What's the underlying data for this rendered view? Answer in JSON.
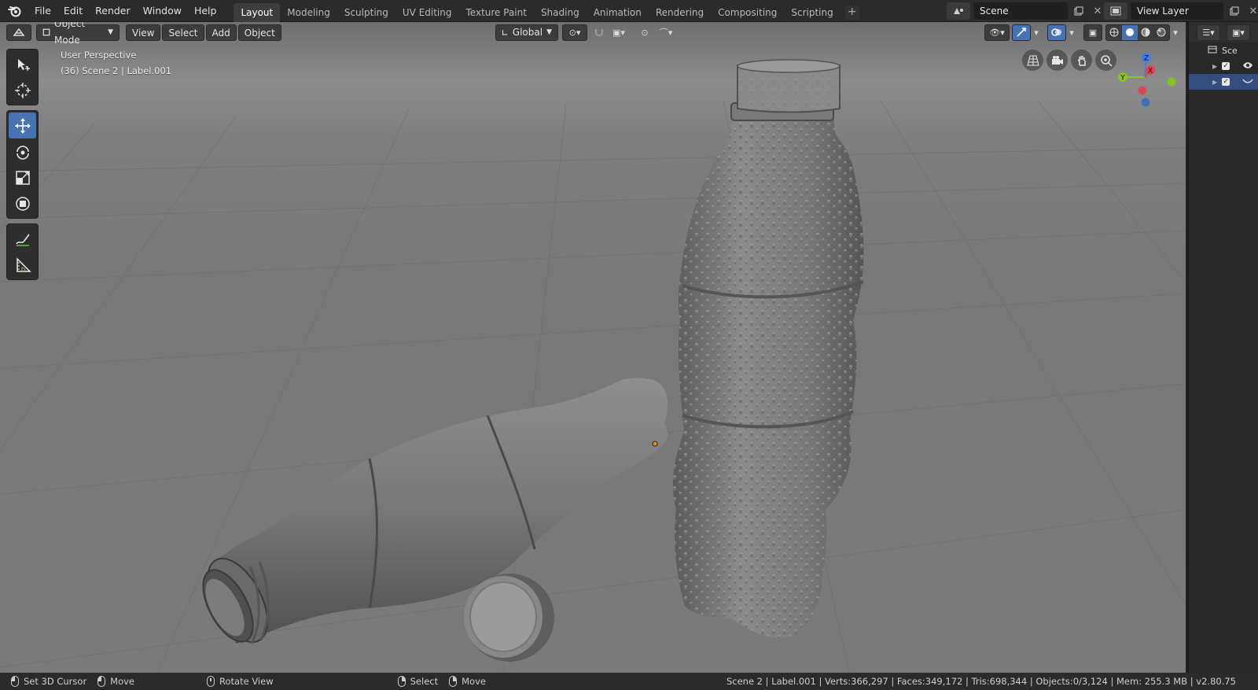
{
  "menu": [
    "File",
    "Edit",
    "Render",
    "Window",
    "Help"
  ],
  "workspaces": [
    "Layout",
    "Modeling",
    "Sculpting",
    "UV Editing",
    "Texture Paint",
    "Shading",
    "Animation",
    "Rendering",
    "Compositing",
    "Scripting"
  ],
  "active_workspace": "Layout",
  "scene_name": "Scene",
  "view_layer_name": "View Layer",
  "viewport_header": {
    "mode": "Object Mode",
    "view": "View",
    "select": "Select",
    "add": "Add",
    "object": "Object",
    "orientation": "Global"
  },
  "overlay": {
    "perspective": "User Perspective",
    "context": "(36) Scene 2 | Label.001"
  },
  "outliner": {
    "header_label": "Sce"
  },
  "statusbar": {
    "left_click": "Set 3D Cursor",
    "left_drag": "Move",
    "middle": "Rotate View",
    "right_click": "Select",
    "right_drag": "Move",
    "stats": "Scene 2 | Label.001 | Verts:366,297 | Faces:349,172 | Tris:698,344 | Objects:0/3,124 | Mem: 255.3 MB | v2.80.75"
  },
  "axis_labels": {
    "x": "X",
    "y": "Y",
    "z": "Z"
  },
  "colors": {
    "accent": "#4772b3",
    "x_axis": "#e5414c",
    "y_axis": "#8bc21e",
    "z_axis": "#3d7fe6"
  }
}
